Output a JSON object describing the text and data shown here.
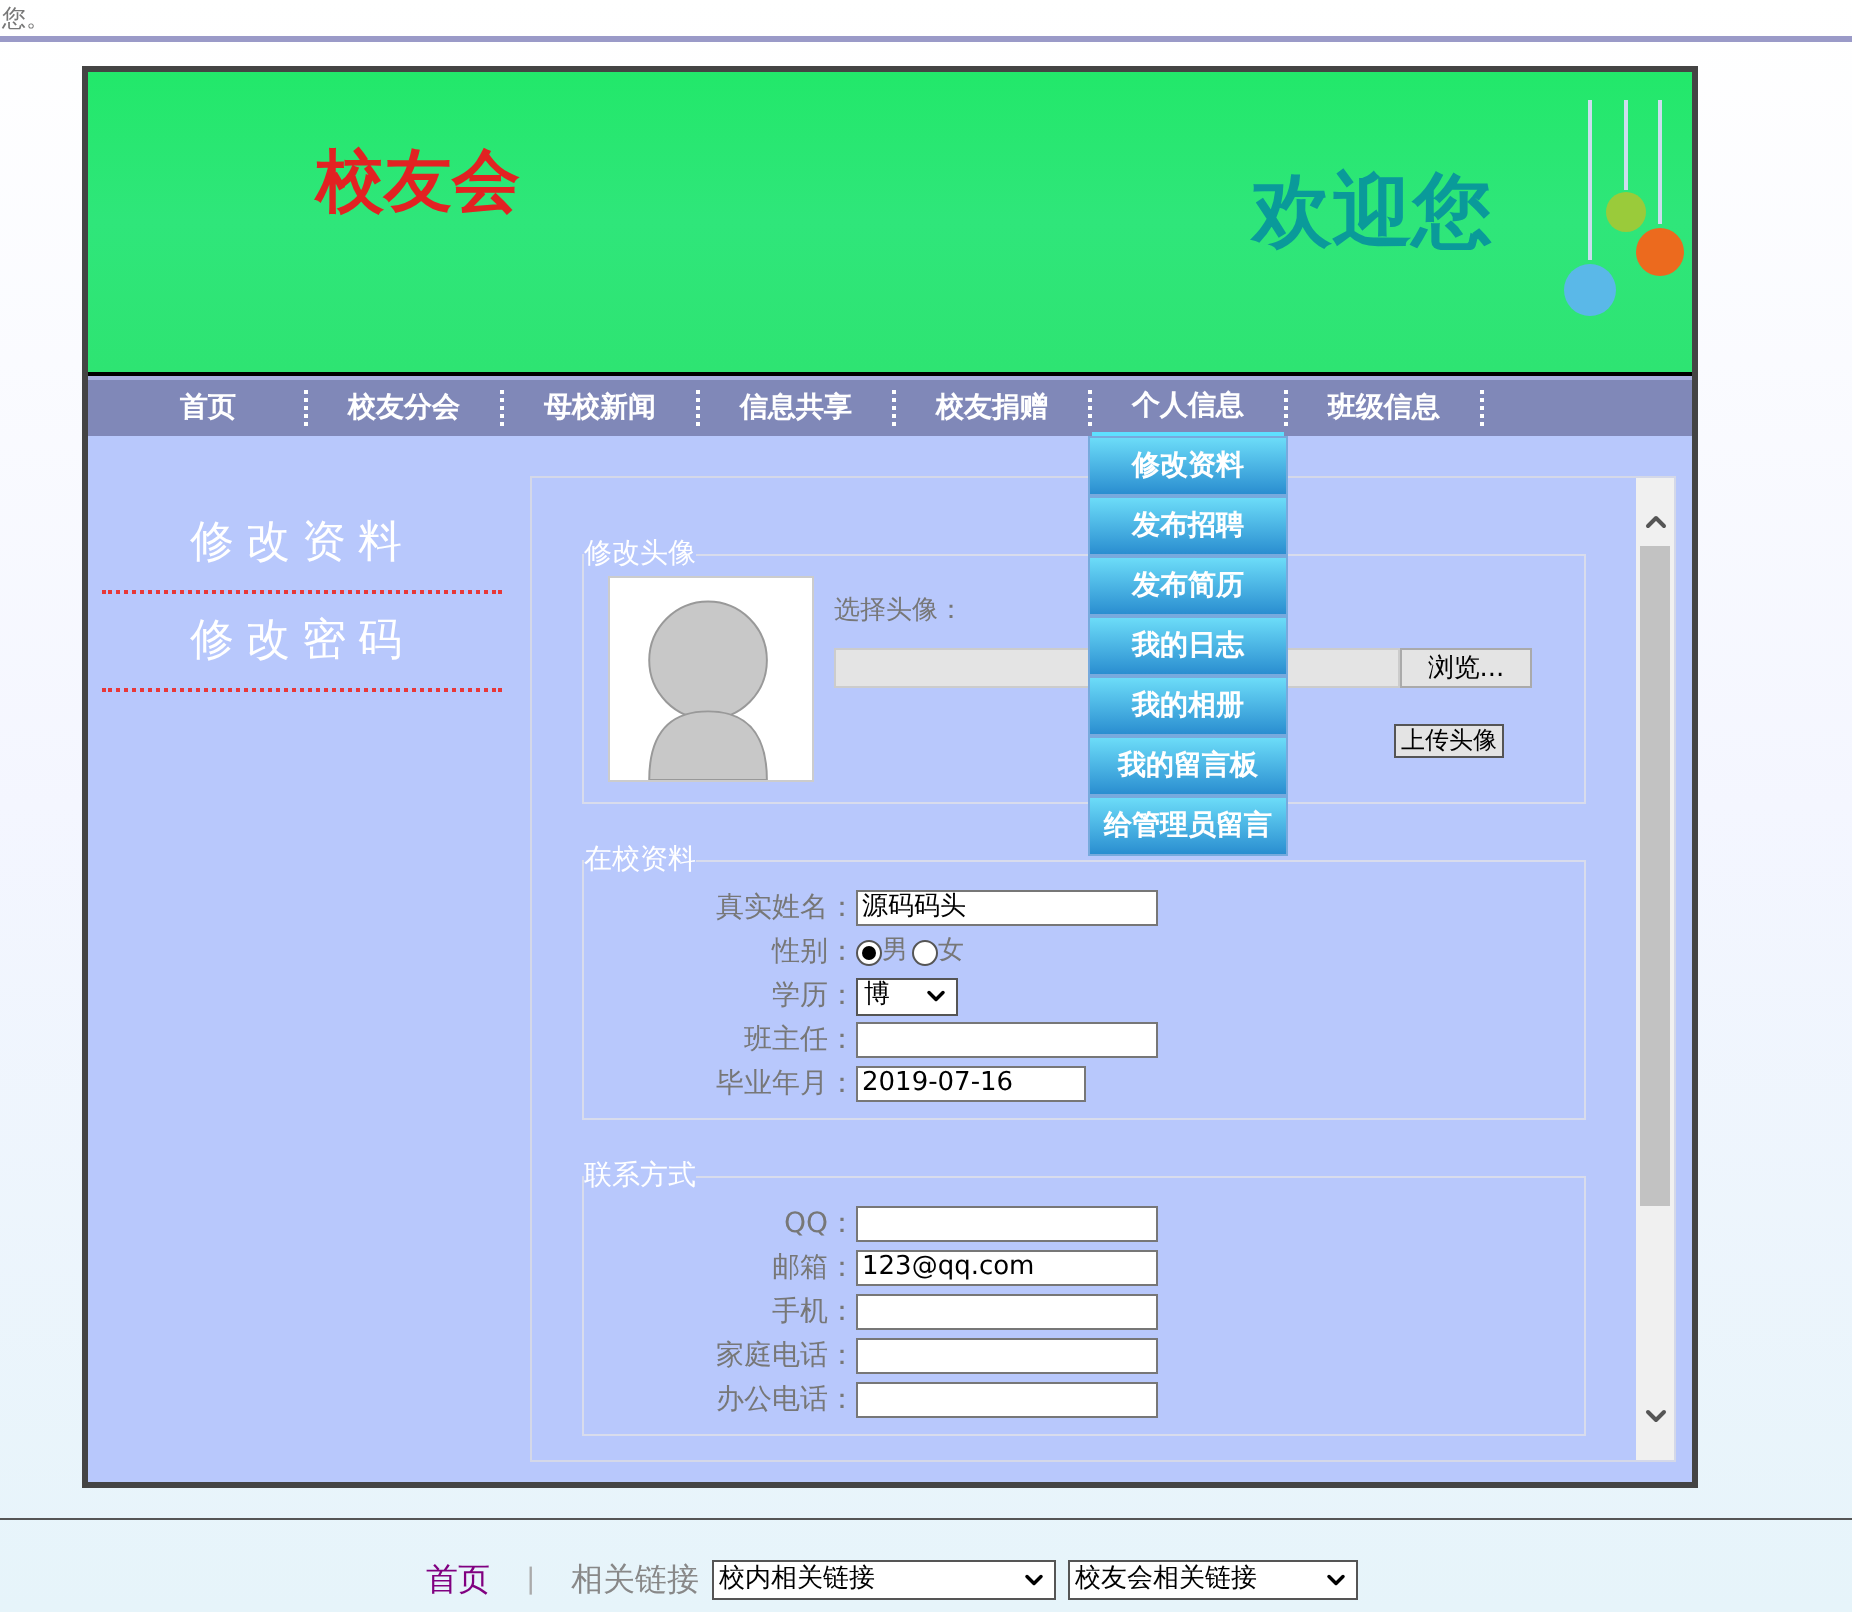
{
  "top_text": "您。",
  "banner": {
    "title": "校友会",
    "welcome": "欢迎您"
  },
  "nav": [
    {
      "label": "首页",
      "selected": false
    },
    {
      "label": "校友分会",
      "selected": false
    },
    {
      "label": "母校新闻",
      "selected": false
    },
    {
      "label": "信息共享",
      "selected": false
    },
    {
      "label": "校友捐赠",
      "selected": false
    },
    {
      "label": "个人信息",
      "selected": true
    },
    {
      "label": "班级信息",
      "selected": false
    }
  ],
  "dropdown": [
    "修改资料",
    "发布招聘",
    "发布简历",
    "我的日志",
    "我的相册",
    "我的留言板",
    "给管理员留言"
  ],
  "sidebar": [
    "修改资料",
    "修改密码"
  ],
  "avatar_section": {
    "legend": "修改头像",
    "choose_label": "选择头像：",
    "browse": "浏览...",
    "upload": "上传头像"
  },
  "school_section": {
    "legend": "在校资料",
    "fields": [
      {
        "kind": "text",
        "label": "真实姓名：",
        "value": "源码码头"
      },
      {
        "kind": "radio",
        "label": "性别：",
        "options": [
          {
            "label": "男",
            "selected": true
          },
          {
            "label": "女",
            "selected": false
          }
        ]
      },
      {
        "kind": "select",
        "label": "学历：",
        "value": "博"
      },
      {
        "kind": "text",
        "label": "班主任："
      },
      {
        "kind": "date",
        "label": "毕业年月：",
        "value": "2019-07-16"
      }
    ]
  },
  "contact_section": {
    "legend": "联系方式",
    "fields": [
      {
        "kind": "text",
        "label": "QQ："
      },
      {
        "kind": "text",
        "label": "邮箱：",
        "value": "123@qq.com"
      },
      {
        "kind": "text",
        "label": "手机："
      },
      {
        "kind": "text",
        "label": "家庭电话："
      },
      {
        "kind": "text",
        "label": "办公电话："
      }
    ]
  },
  "footer": {
    "home": "首页",
    "separator": "|",
    "links_label": "相关链接",
    "select_1": "校内相关链接",
    "select_2": "校友会相关链接"
  }
}
